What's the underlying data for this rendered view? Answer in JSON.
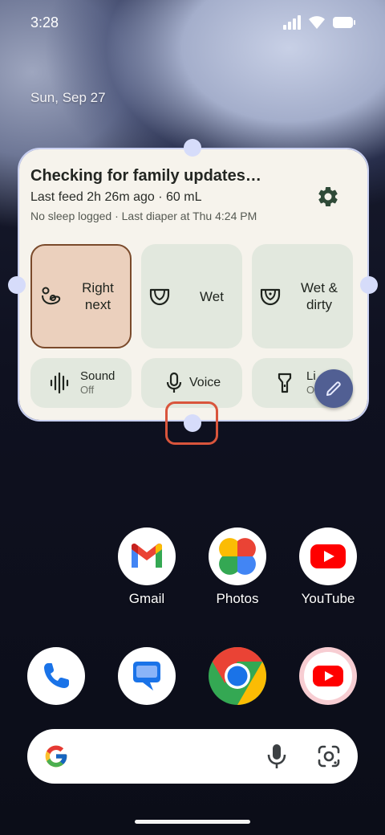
{
  "status_bar": {
    "time": "3:28",
    "icons": [
      "signal-icon",
      "wifi-icon",
      "battery-icon"
    ]
  },
  "lock_date": "Sun, Sep 27",
  "widget": {
    "title": "Checking for family updates…",
    "last_feed": "Last feed 2h 26m ago · 60 mL",
    "status_line": "No sleep logged · Last diaper at Thu 4:24 PM",
    "settings_icon": "gear-icon",
    "tiles": [
      {
        "label": "Right next",
        "icon": "breastfeeding-icon",
        "selected": true
      },
      {
        "label": "Wet",
        "icon": "diaper-icon"
      },
      {
        "label": "Wet & dirty",
        "icon": "diaper-dirty-icon"
      }
    ],
    "small_tiles": [
      {
        "label": "Sound",
        "sublabel": "Off",
        "icon": "soundwave-icon"
      },
      {
        "label": "Voice",
        "icon": "microphone-icon"
      },
      {
        "label": "Li",
        "sublabel": "O",
        "icon": "flashlight-icon"
      }
    ],
    "edit_icon": "pencil-icon"
  },
  "apps_row": [
    {
      "label": "Gmail",
      "icon": "gmail-icon"
    },
    {
      "label": "Photos",
      "icon": "photos-icon"
    },
    {
      "label": "YouTube",
      "icon": "youtube-icon"
    }
  ],
  "dock": [
    {
      "icon": "phone-icon"
    },
    {
      "icon": "messages-icon"
    },
    {
      "icon": "chrome-icon"
    },
    {
      "icon": "youtube-music-icon"
    }
  ],
  "search": {
    "logo": "google-g-icon",
    "mic": "microphone-icon",
    "lens": "lens-icon"
  },
  "colors": {
    "widget_bg": "#f6f3ec",
    "tile_bg": "#e2e8de",
    "selected_tile_bg": "#ebd0bd",
    "selected_tile_border": "#7a4a2b",
    "resize_handle": "#d6dcfa",
    "edit_fab": "#515f93",
    "highlight": "#d9553c"
  }
}
